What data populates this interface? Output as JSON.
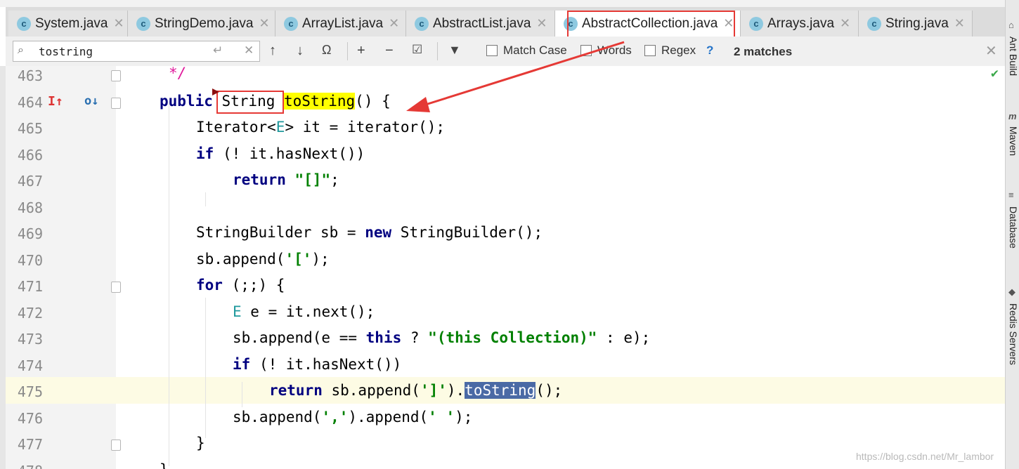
{
  "tabs": [
    {
      "label": "System.java"
    },
    {
      "label": "StringDemo.java"
    },
    {
      "label": "ArrayList.java"
    },
    {
      "label": "AbstractList.java"
    },
    {
      "label": "AbstractCollection.java"
    },
    {
      "label": "Arrays.java"
    },
    {
      "label": "String.java"
    }
  ],
  "search": {
    "value": "tostring",
    "match_case": "Match Case",
    "words": "Words",
    "regex": "Regex",
    "help": "?",
    "matches": "2 matches"
  },
  "code": {
    "lines": [
      "463",
      "464",
      "465",
      "466",
      "467",
      "468",
      "469",
      "470",
      "471",
      "472",
      "473",
      "474",
      "475",
      "476",
      "477",
      "478"
    ]
  },
  "right_tools": {
    "ant": "Ant Build",
    "maven": "Maven",
    "database": "Database",
    "redis": "Redis Servers"
  },
  "watermark": "https://blog.csdn.net/Mr_lambor",
  "colors": {
    "highlight": "#ffff00",
    "selection": "#4a6aa5",
    "annotation": "#e53935"
  }
}
